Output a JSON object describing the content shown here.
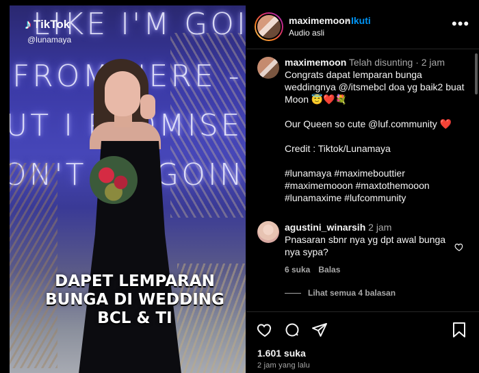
{
  "media": {
    "tiktok_brand": "TikTok",
    "tiktok_handle": "@lunamaya",
    "neon_lines": [
      "LIKE I'M GOIN",
      "FROM HERE -",
      "UT I PROMISE I",
      "ON'T BE GOIN"
    ],
    "overlay_lines": [
      "DAPET LEMPARAN",
      "BUNGA DI WEDDING",
      "BCL & TI"
    ]
  },
  "header": {
    "username": "maximemoon",
    "separator": "•",
    "follow_label": "Ikuti",
    "audio": "Audio asli",
    "more_icon": "more-horizontal-icon"
  },
  "caption": {
    "username": "maximemoon",
    "edited": "Telah disunting",
    "separator": "·",
    "time": "2 jam",
    "line1": "Congrats dapat lemparan bunga weddingnya @/itsmebcl doa yg baik2 buat Moon 😇❤️💐",
    "line2": "Our Queen so cute @luf.community ❤️",
    "line3": "Credit : Tiktok/Lunamaya",
    "hashtags": "#lunamaya #maximebouttier #maximemooon #maxtothemooon #lunamaxime #lufcommunity"
  },
  "comment": {
    "username": "agustini_winarsih",
    "time": "2 jam",
    "text": "Pnasaran sbnr nya yg dpt awal bunga nya sypa?",
    "likes_label": "6 suka",
    "reply_label": "Balas",
    "view_replies": "Lihat semua 4 balasan"
  },
  "actions": {
    "likes": "1.601 suka",
    "time": "2 jam yang lalu"
  },
  "colors": {
    "follow_blue": "#0095f6",
    "muted": "#a8a8a8",
    "background": "#000000"
  }
}
